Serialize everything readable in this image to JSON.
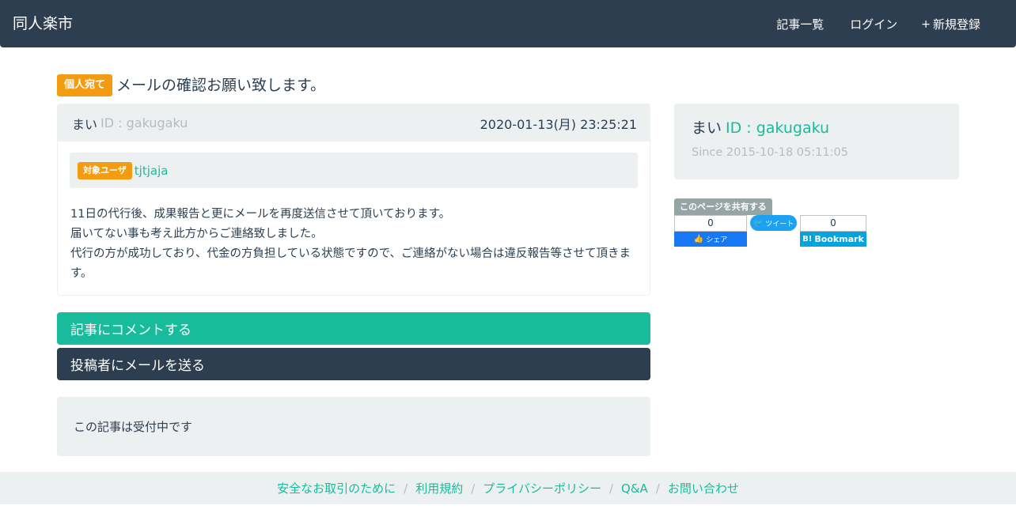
{
  "navbar": {
    "brand": "同人楽市",
    "items": [
      {
        "icon": "",
        "label": "記事一覧"
      },
      {
        "icon": "",
        "label": "ログイン"
      },
      {
        "icon": "+",
        "label": "新規登録"
      }
    ]
  },
  "article": {
    "badge": "個人宛て",
    "title": "メールの確認お願い致します。",
    "author_name": "まい",
    "author_id": "ID : gakugaku",
    "date": "2020-01-13(月) 23:25:21",
    "target_badge": "対象ユーザ",
    "target_user": "tjtjaja",
    "body_lines": [
      "11日の代行後、成果報告と更にメールを再度送信させて頂いております。",
      "届いてない事も考え此方からご連絡致しました。",
      "代行の方が成功しており、代金の方負担している状態ですので、ご連絡がない場合は違反報告等させて頂きます。"
    ]
  },
  "actions": {
    "comment_label": "記事にコメントする",
    "mail_label": "投稿者にメールを送る"
  },
  "status": {
    "text": "この記事は受付中です"
  },
  "profile": {
    "name": "まい",
    "id": "ID : gakugaku",
    "since": "Since 2015-10-18 05:11:05"
  },
  "share": {
    "label": "このページを共有する",
    "fb_count": "0",
    "fb_label": "シェア",
    "tw_label": "ツイート",
    "hb_count": "0",
    "hb_label": "Bookmark",
    "hb_logo": "B!"
  },
  "footer": {
    "links": [
      "安全なお取引のために",
      "利用規約",
      "プライバシーポリシー",
      "Q&A",
      "お問い合わせ"
    ]
  },
  "colors": {
    "primary": "#2c3e50",
    "success": "#18bc9c",
    "warning": "#f39c12",
    "light": "#ecf0f1",
    "muted": "#b4bcc2",
    "facebook": "#1877f2",
    "twitter": "#1da1f2",
    "hatena": "#00a4de"
  }
}
